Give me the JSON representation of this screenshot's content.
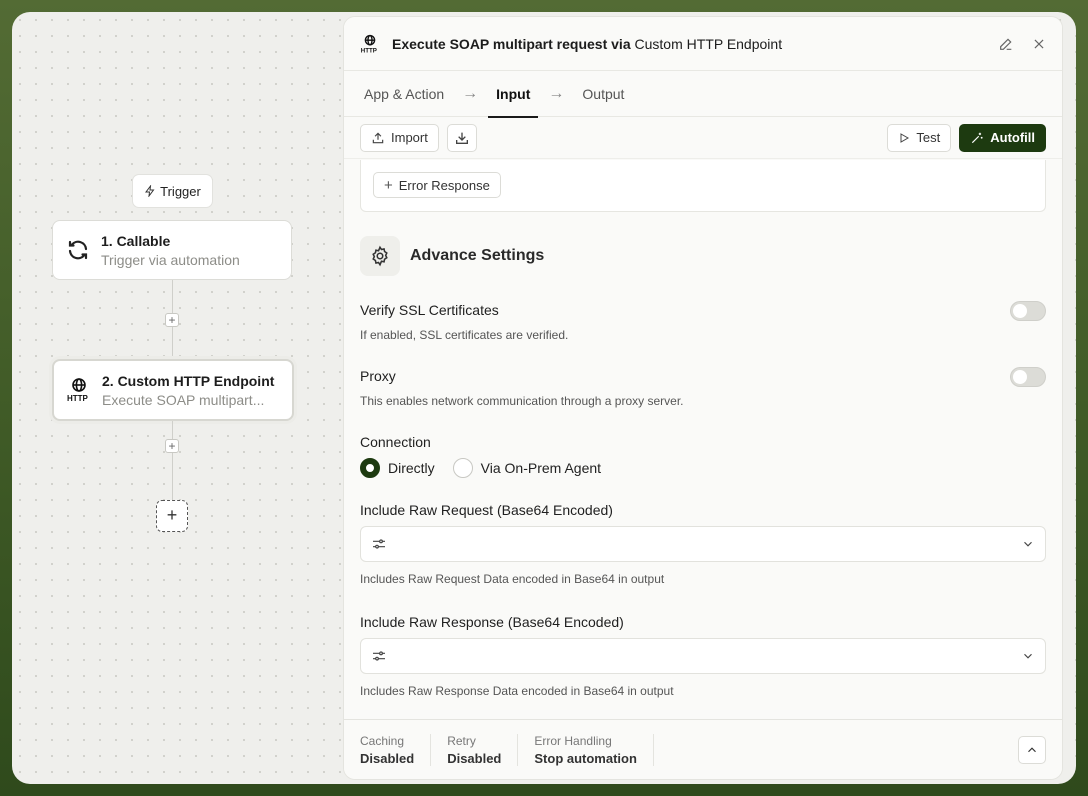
{
  "canvas": {
    "trigger_label": "Trigger",
    "node1": {
      "title": "1. Callable",
      "subtitle": "Trigger via automation"
    },
    "node2": {
      "title": "2. Custom HTTP Endpoint",
      "subtitle": "Execute SOAP multipart..."
    }
  },
  "panel": {
    "title_bold": "Execute SOAP multipart request via",
    "title_rest": "Custom HTTP Endpoint",
    "tabs": [
      "App & Action",
      "Input",
      "Output"
    ],
    "toolbar": {
      "import": "Import",
      "test": "Test",
      "autofill": "Autofill"
    },
    "error_response_btn": "Error Response",
    "advance_settings": "Advance Settings",
    "verify_ssl": {
      "label": "Verify SSL Certificates",
      "desc": "If enabled, SSL certificates are verified."
    },
    "proxy": {
      "label": "Proxy",
      "desc": "This enables network communication through a proxy server."
    },
    "connection": {
      "label": "Connection",
      "opt1": "Directly",
      "opt2": "Via On-Prem Agent"
    },
    "raw_request": {
      "label": "Include Raw Request (Base64 Encoded)",
      "desc": "Includes Raw Request Data encoded in Base64 in output"
    },
    "raw_response": {
      "label": "Include Raw Response (Base64 Encoded)",
      "desc": "Includes Raw Response Data encoded in Base64 in output"
    },
    "footer": {
      "caching": {
        "k": "Caching",
        "v": "Disabled"
      },
      "retry": {
        "k": "Retry",
        "v": "Disabled"
      },
      "error": {
        "k": "Error Handling",
        "v": "Stop automation"
      }
    }
  }
}
